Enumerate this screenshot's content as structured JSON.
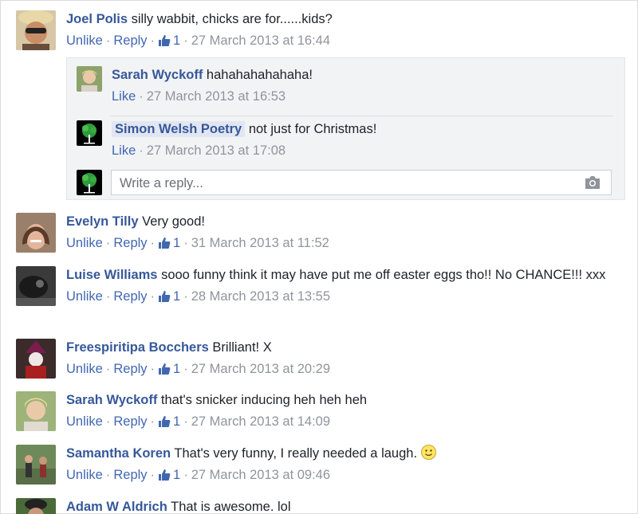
{
  "comments": [
    {
      "author": "Joel Polis",
      "text": "silly wabbit, chicks are for......kids?",
      "actions": [
        "Unlike",
        "Reply"
      ],
      "likes": "1",
      "time": "27 March 2013 at 16:44"
    },
    {
      "author": "Evelyn Tilly",
      "text": "Very good!",
      "actions": [
        "Unlike",
        "Reply"
      ],
      "likes": "1",
      "time": "31 March 2013 at 11:52"
    },
    {
      "author": "Luise Williams",
      "text": "sooo funny think it may have put me off easter eggs tho!! No CHANCE!!! xxx",
      "actions": [
        "Unlike",
        "Reply"
      ],
      "likes": "1",
      "time": "28 March 2013 at 13:55"
    },
    {
      "author": "Freespiritipa Bocchers",
      "text": "Brilliant! X",
      "actions": [
        "Unlike",
        "Reply"
      ],
      "likes": "1",
      "time": "27 March 2013 at 20:29"
    },
    {
      "author": "Sarah Wyckoff",
      "text": "that's snicker inducing heh heh heh",
      "actions": [
        "Unlike",
        "Reply"
      ],
      "likes": "1",
      "time": "27 March 2013 at 14:09"
    },
    {
      "author": "Samantha Koren",
      "text": "That's very funny, I really needed a laugh.",
      "actions": [
        "Unlike",
        "Reply"
      ],
      "likes": "1",
      "time": "27 March 2013 at 09:46"
    },
    {
      "author": "Adam W Aldrich",
      "text": "That is awesome. lol"
    }
  ],
  "replies": [
    {
      "author": "Sarah Wyckoff",
      "text": "hahahahahahaha!",
      "action": "Like",
      "time": "27 March 2013 at 16:53"
    },
    {
      "author": "Simon Welsh Poetry",
      "text": "not just for Christmas!",
      "action": "Like",
      "time": "27 March 2013 at 17:08"
    }
  ],
  "reply_box": {
    "placeholder": "Write a reply..."
  },
  "icons": {
    "like": "thumbs-up-icon",
    "camera": "camera-icon",
    "emoji": "smiley-emoji"
  },
  "colors": {
    "author": "#365899",
    "action": "#4267b2",
    "meta": "#90949c",
    "reply_bg": "#f2f3f5"
  }
}
